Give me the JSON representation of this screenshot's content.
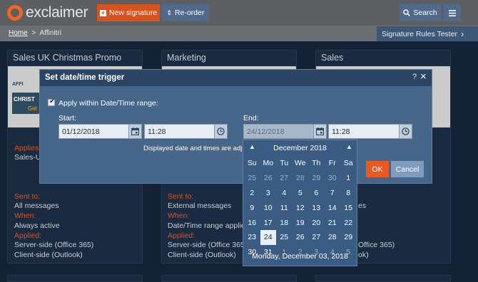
{
  "header": {
    "logo_text": "exclaimer",
    "new_signature": "New signature",
    "reorder": "Re-order",
    "search": "Search"
  },
  "breadcrumb": {
    "home": "Home",
    "separator": ">",
    "current": "Affinitri"
  },
  "rules_tester": "Signature Rules Tester",
  "cards": [
    {
      "title": "Sales UK Christmas Promo",
      "thumb_lines": [
        "AFFI",
        "CHRIST",
        "Get"
      ],
      "applies_label": "Applies",
      "applies_value": "Sales-UK",
      "sent_to_label": "Sent to:",
      "sent_to_value": "All messages",
      "when_label": "When:",
      "when_value": "Always active",
      "applied_label": "Applied:",
      "applied_values": [
        "Server-side (Office 365)",
        "Client-side (Outlook)"
      ]
    },
    {
      "title": "Marketing",
      "sent_to_label": "Sent to:",
      "sent_to_value": "External messages",
      "when_label": "When:",
      "when_value": "Date/Time range applies",
      "applied_label": "Applied:",
      "applied_values": [
        "Server-side (Office 365)",
        "Client-side (Outlook)"
      ]
    },
    {
      "title": "Sales",
      "partial_values": [
        "es",
        "Office 365)",
        "ok)"
      ]
    }
  ],
  "modal": {
    "title": "Set date/time trigger",
    "help": "?",
    "checkbox_label": "Apply within Date/Time range:",
    "checkbox_checked": true,
    "start_label": "Start:",
    "start_date": "01/12/2018",
    "start_time": "11:28",
    "end_label": "End:",
    "end_date": "24/12/2018",
    "end_time": "11:28",
    "note": "Displayed date and times are adjuste",
    "ok": "OK",
    "cancel": "Cancel"
  },
  "datepicker": {
    "month_label": "December 2018",
    "weekdays": [
      "Su",
      "Mo",
      "Tu",
      "We",
      "Th",
      "Fr",
      "Sa"
    ],
    "weeks": [
      [
        "25",
        "26",
        "27",
        "28",
        "29",
        "30",
        "1"
      ],
      [
        "2",
        "3",
        "4",
        "5",
        "6",
        "7",
        "8"
      ],
      [
        "9",
        "10",
        "11",
        "12",
        "13",
        "14",
        "15"
      ],
      [
        "16",
        "17",
        "18",
        "19",
        "20",
        "21",
        "22"
      ],
      [
        "23",
        "24",
        "25",
        "26",
        "27",
        "28",
        "29"
      ],
      [
        "30",
        "31",
        "1",
        "2",
        "3",
        "4",
        "5"
      ]
    ],
    "other_month_cells": [
      "0-0",
      "0-1",
      "0-2",
      "0-3",
      "0-4",
      "0-5",
      "5-2",
      "5-3",
      "5-4",
      "5-5",
      "5-6"
    ],
    "selected_cell": "4-1",
    "footer": "Monday, December 03, 2018"
  },
  "colors": {
    "accent": "#e85a21",
    "header_bg": "#5d5f63",
    "modal_bg": "#46668a",
    "modal_head": "#2b4664",
    "page_bg": "#142236"
  }
}
